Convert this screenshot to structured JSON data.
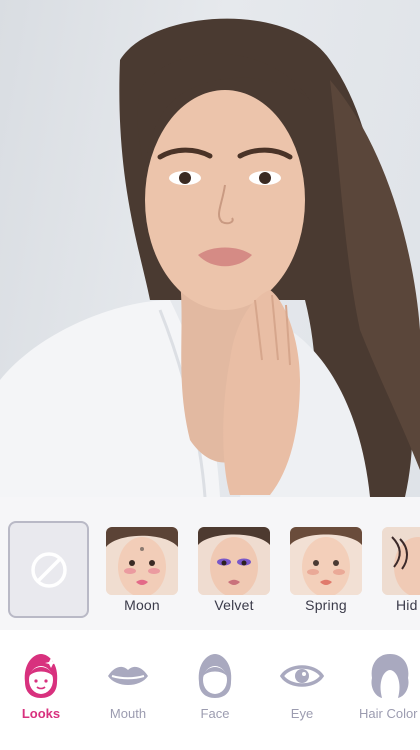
{
  "looks": [
    {
      "name": "Moon",
      "accent": "#e36a88"
    },
    {
      "name": "Velvet",
      "accent": "#7a58c8"
    },
    {
      "name": "Spring",
      "accent": "#e07a6c"
    },
    {
      "name": "Hid",
      "accent": "#3c2a2a"
    }
  ],
  "nav": {
    "items": [
      {
        "label": "Looks",
        "icon": "looks-icon"
      },
      {
        "label": "Mouth",
        "icon": "lips-icon"
      },
      {
        "label": "Face",
        "icon": "face-icon"
      },
      {
        "label": "Eye",
        "icon": "eye-icon"
      },
      {
        "label": "Hair Color",
        "icon": "hair-icon"
      }
    ],
    "active": "Looks"
  },
  "colors": {
    "accent": "#d8317e",
    "inactive": "#a9a9bf"
  }
}
